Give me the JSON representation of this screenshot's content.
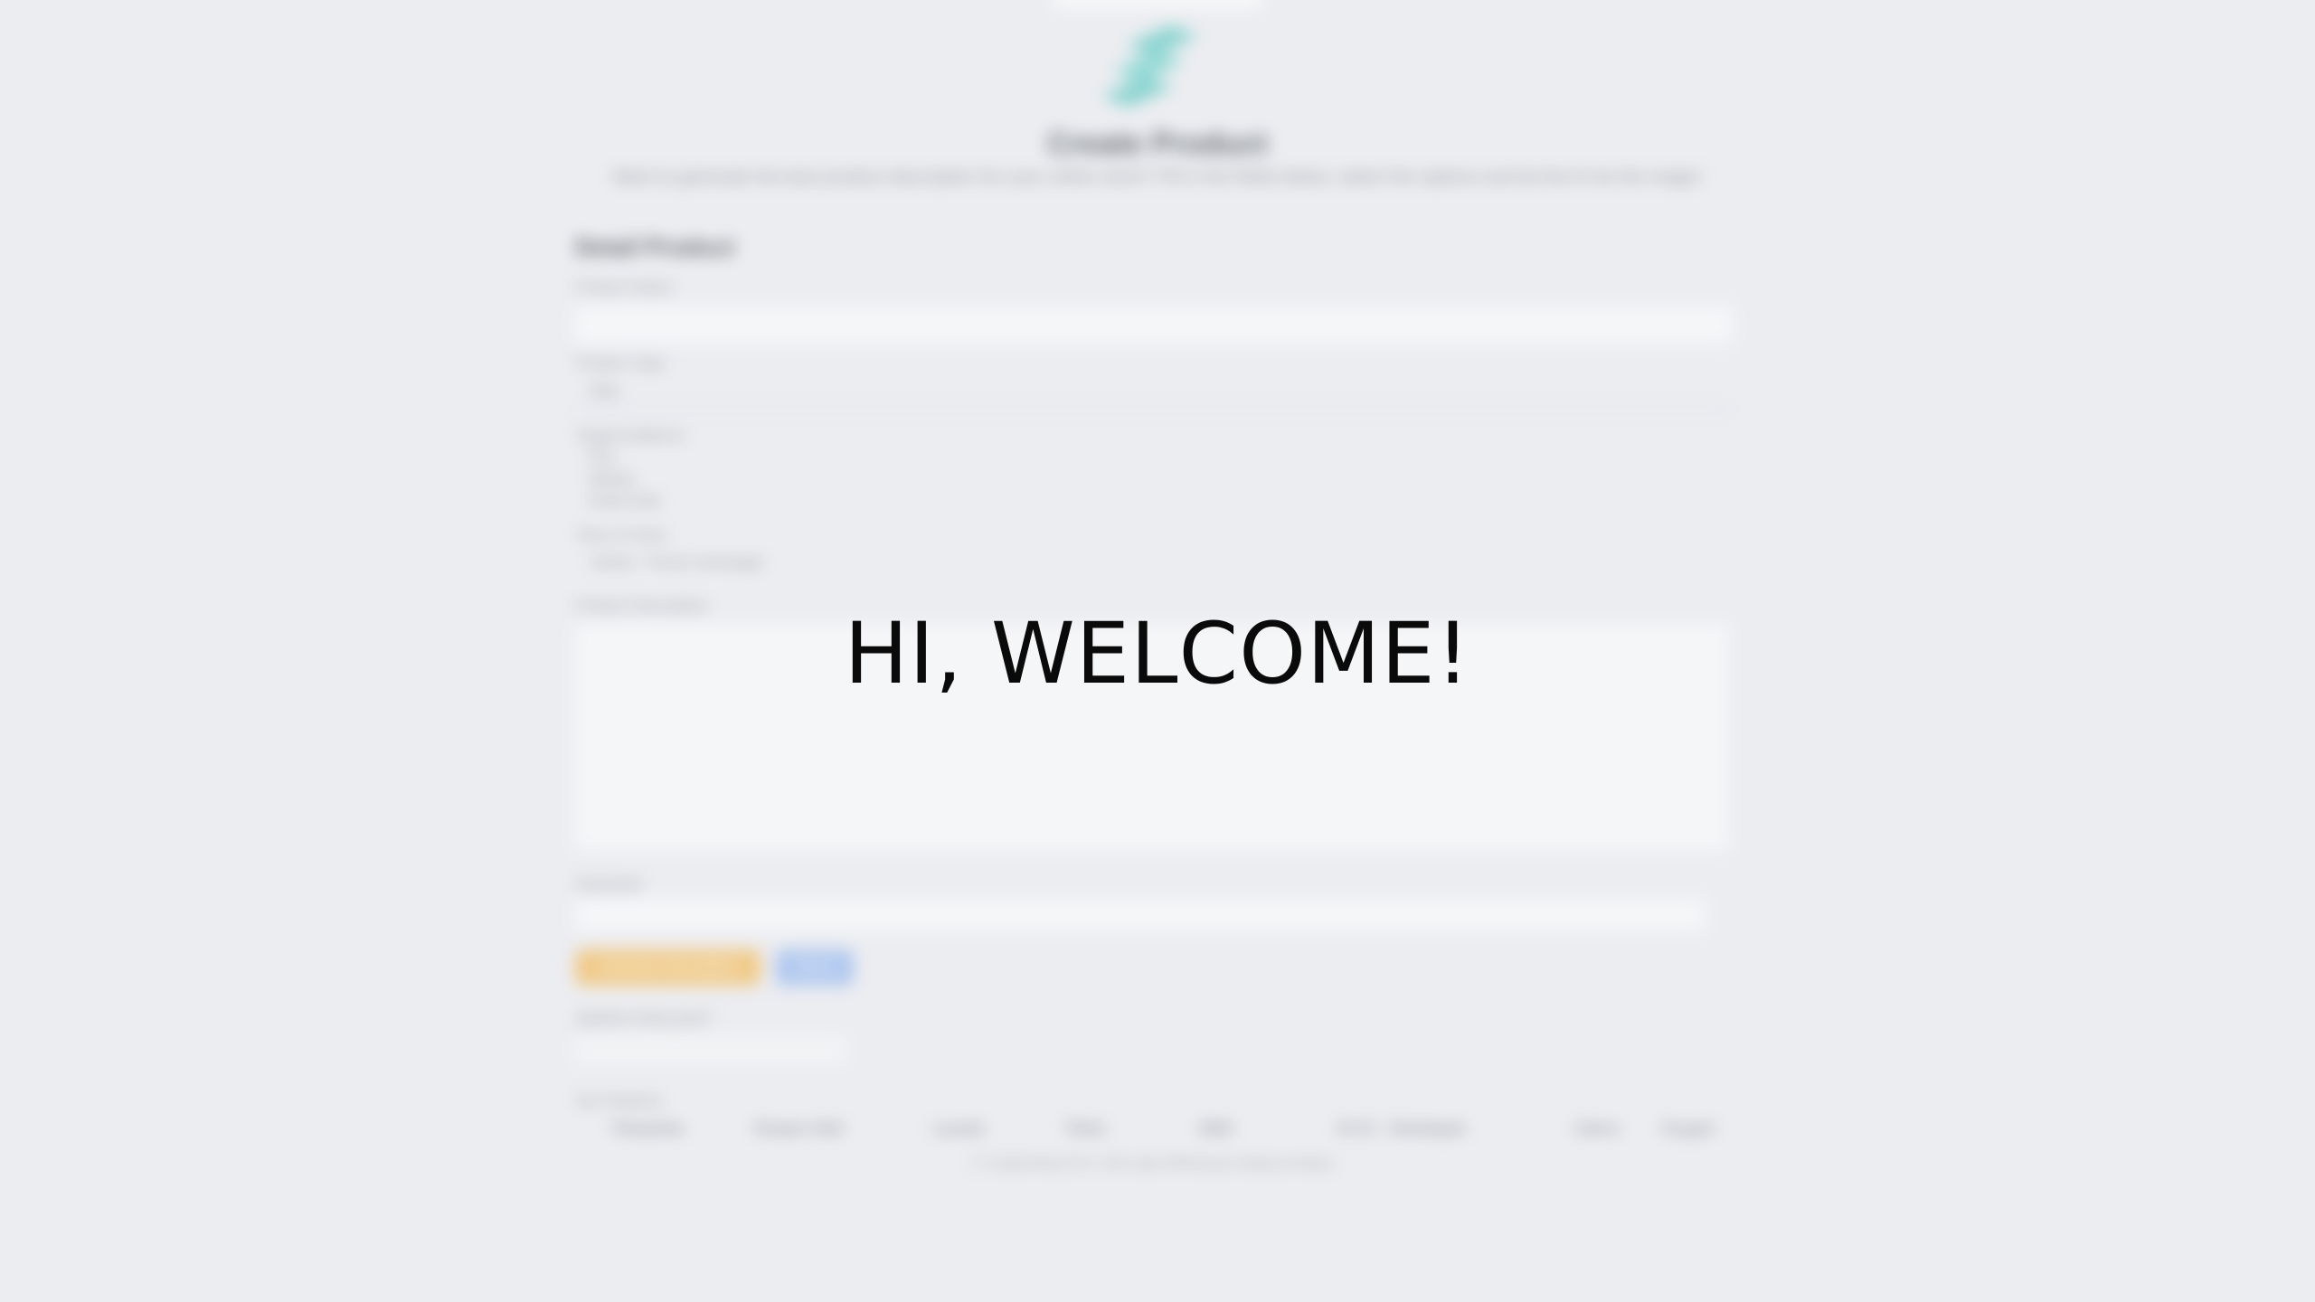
{
  "overlay": {
    "welcome": "HI, WELCOME!"
  },
  "app": {
    "title": "Create Product",
    "description": "Want to generate the best product description for your online store? Fill in the fields below, select the options and let the AI do the magic!",
    "description_line2": "",
    "logo_icon": "logo-waves-icon",
    "brand_color": "#7fd1cc"
  },
  "form": {
    "section_title": "Detail Product",
    "product_name_label": "Product Name",
    "product_name_value": "",
    "product_type_label": "Product Type",
    "product_type_value": "Baju",
    "target_audience_label": "Target Audience",
    "target_audience_options": [
      "Pria",
      "Wanita"
    ],
    "target_audience_extra": "Anak-anak",
    "tone_label": "Tone of Voice",
    "tone_value": "Santai - Penuh semangat",
    "description_label": "Product Description",
    "description_value": "",
    "keyword_label": "Keywords",
    "keyword_value": "",
    "generate_button": "Generate Description",
    "reset_button": "Reset",
    "feedback_label": "Apakah Anda puas?",
    "feedback_value": ""
  },
  "footer": {
    "heading": "Our Partners",
    "links": [
      "Tokopedia",
      "Shopee Mall",
      "Lazada",
      "Tiktok",
      "Blibli",
      "JD.ID - Bukalapak",
      "Zalora",
      "Oxygen"
    ],
    "copyright": "© Copywriting Tool. Hak cipta dilindungi undang-undang."
  },
  "colors": {
    "background": "#ecedf1",
    "generate_button": "#f1c77e",
    "reset_button": "#a9c4ef",
    "overlay_text": "#0a0a0a"
  }
}
